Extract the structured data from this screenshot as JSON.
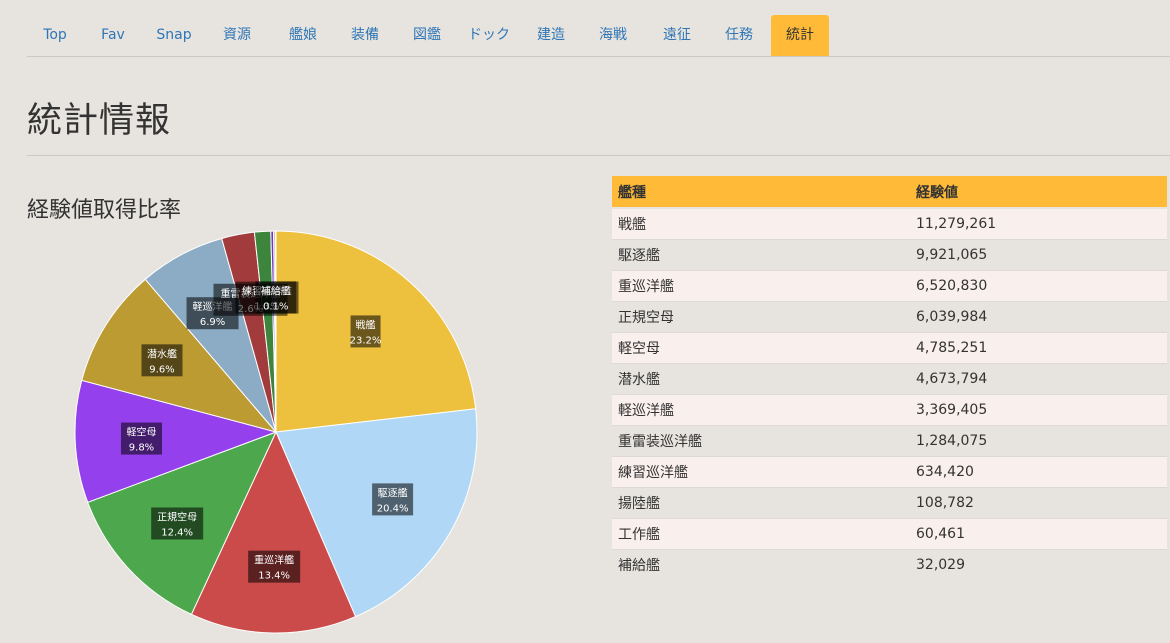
{
  "nav": {
    "tabs": [
      {
        "label": "Top",
        "active": false
      },
      {
        "label": "Fav",
        "active": false
      },
      {
        "label": "Snap",
        "active": false
      },
      {
        "label": "資源",
        "active": false
      },
      {
        "label": "艦娘",
        "active": false
      },
      {
        "label": "装備",
        "active": false
      },
      {
        "label": "図鑑",
        "active": false
      },
      {
        "label": "ドック",
        "active": false
      },
      {
        "label": "建造",
        "active": false
      },
      {
        "label": "海戦",
        "active": false
      },
      {
        "label": "遠征",
        "active": false
      },
      {
        "label": "任務",
        "active": false
      },
      {
        "label": "統計",
        "active": true
      }
    ]
  },
  "page": {
    "title": "統計情報"
  },
  "colors": {
    "accent": "#ffba38",
    "link": "#2f76b6",
    "background": "#e7e4df"
  },
  "chart_data": {
    "type": "pie",
    "title": "経験値取得比率",
    "slices": [
      {
        "label": "戦艦",
        "percent_label": "23.2%",
        "value": 11279261,
        "color": "#edc03e"
      },
      {
        "label": "駆逐艦",
        "percent_label": "20.4%",
        "value": 9921065,
        "color": "#b0d8f6"
      },
      {
        "label": "重巡洋艦",
        "percent_label": "13.4%",
        "value": 6520830,
        "color": "#cb4b4b"
      },
      {
        "label": "正規空母",
        "percent_label": "12.4%",
        "value": 6039984,
        "color": "#4da74d"
      },
      {
        "label": "軽空母",
        "percent_label": "9.8%",
        "value": 4785251,
        "color": "#9440ed"
      },
      {
        "label": "潜水艦",
        "percent_label": "9.6%",
        "value": 4673794,
        "color": "#bd9b33"
      },
      {
        "label": "軽巡洋艦",
        "percent_label": "6.9%",
        "value": 3369405,
        "color": "#8cacc6"
      },
      {
        "label": "重雷装巡洋艦",
        "percent_label": "2.6%",
        "value": 1284075,
        "color": "#a23c3c"
      },
      {
        "label": "練習巡洋艦",
        "percent_label": "1.3%",
        "value": 634420,
        "color": "#3d853d"
      },
      {
        "label": "揚陸艦",
        "percent_label": "0.2%",
        "value": 108782,
        "color": "#7633bd"
      },
      {
        "label": "工作艦",
        "percent_label": "0.1%",
        "value": 60461,
        "color": "#97822b"
      },
      {
        "label": "補給艦",
        "percent_label": "0.1%",
        "value": 32029,
        "color": "#7a92a6"
      }
    ],
    "visible_labels": [
      "戦艦",
      "駆逐艦",
      "重巡洋艦",
      "正規空母",
      "軽空母",
      "潜水艦",
      "軽巡洋艦",
      "重雷装巡洋艦",
      "練習巡洋艦",
      "補給艦"
    ]
  },
  "table": {
    "headers": [
      "艦種",
      "経験値"
    ],
    "rows": [
      [
        "戦艦",
        "11,279,261"
      ],
      [
        "駆逐艦",
        "9,921,065"
      ],
      [
        "重巡洋艦",
        "6,520,830"
      ],
      [
        "正規空母",
        "6,039,984"
      ],
      [
        "軽空母",
        "4,785,251"
      ],
      [
        "潜水艦",
        "4,673,794"
      ],
      [
        "軽巡洋艦",
        "3,369,405"
      ],
      [
        "重雷装巡洋艦",
        "1,284,075"
      ],
      [
        "練習巡洋艦",
        "634,420"
      ],
      [
        "揚陸艦",
        "108,782"
      ],
      [
        "工作艦",
        "60,461"
      ],
      [
        "補給艦",
        "32,029"
      ]
    ]
  }
}
